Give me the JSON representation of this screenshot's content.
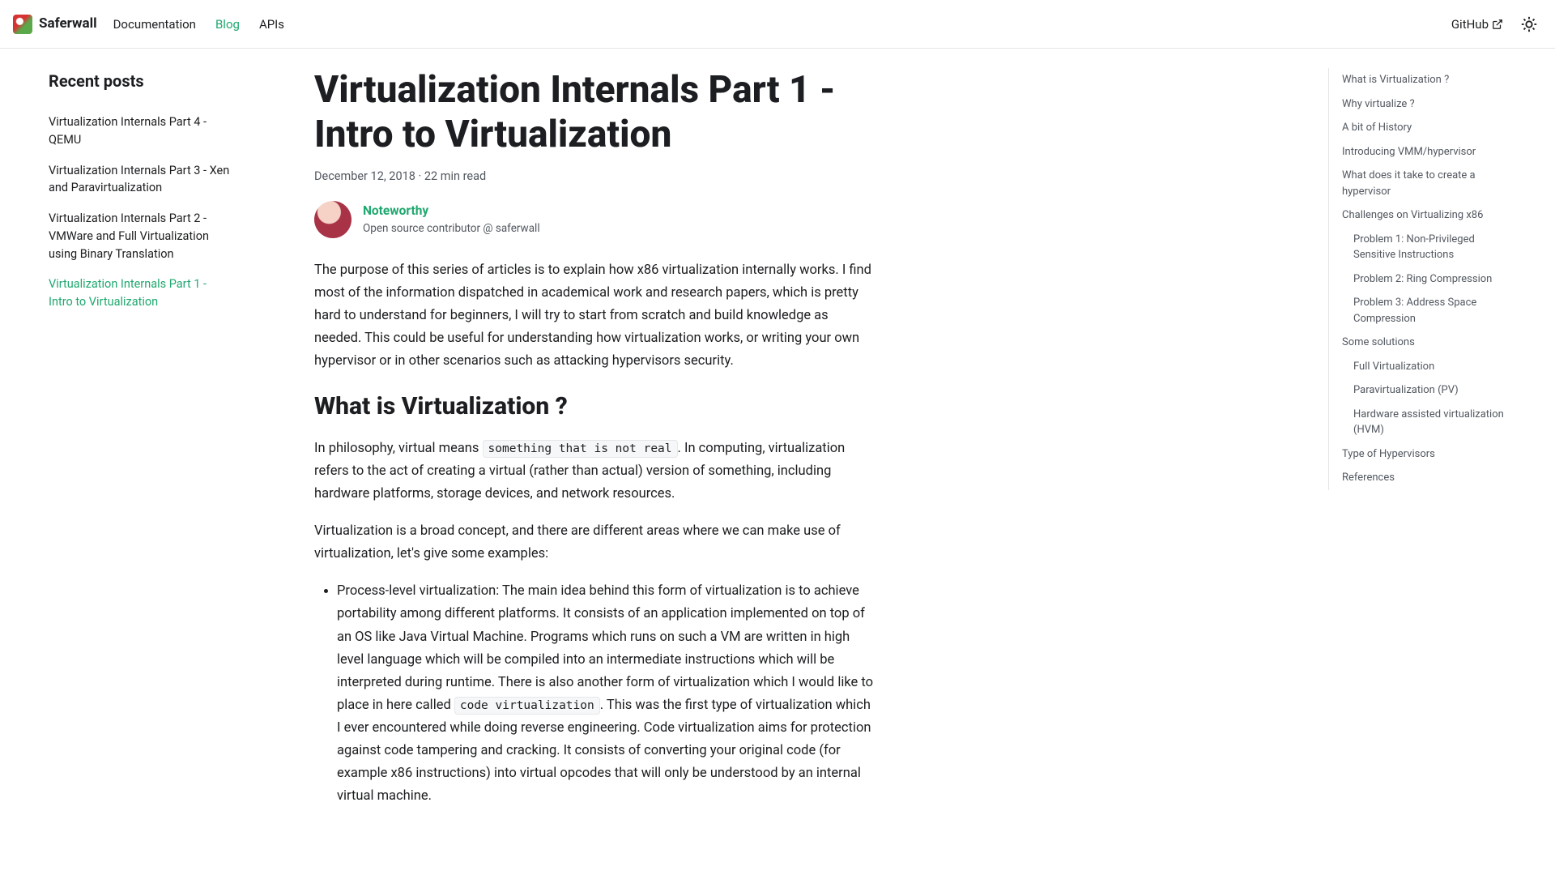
{
  "nav": {
    "brand": "Saferwall",
    "links": [
      "Documentation",
      "Blog",
      "APIs"
    ],
    "active_index": 1,
    "github": "GitHub"
  },
  "sidebar": {
    "heading": "Recent posts",
    "posts": [
      "Virtualization Internals Part 4 - QEMU",
      "Virtualization Internals Part 3 - Xen and Paravirtualization",
      "Virtualization Internals Part 2 - VMWare and Full Virtualization using Binary Translation",
      "Virtualization Internals Part 1 - Intro to Virtualization"
    ],
    "active_index": 3
  },
  "post": {
    "title": "Virtualization Internals Part 1 - Intro to Virtualization",
    "meta": "December 12, 2018 · 22 min read",
    "author_name": "Noteworthy",
    "author_role": "Open source contributor @ saferwall",
    "intro_p": "The purpose of this series of articles is to explain how x86 virtualization internally works. I find most of the information dispatched in academical work and research papers, which is pretty hard to understand for beginners, I will try to start from scratch and build knowledge as needed. This could be useful for understanding how virtualization works, or writing your own hypervisor or in other scenarios such as attacking hypervisors security.",
    "h2_1": "What is Virtualization ?",
    "p2_pre": "In philosophy, virtual means ",
    "code1": "something that is not real",
    "p2_post": ". In computing, virtualization refers to the act of creating a virtual (rather than actual) version of something, including hardware platforms, storage devices, and network resources.",
    "p3": "Virtualization is a broad concept, and there are different areas where we can make use of virtualization, let's give some examples:",
    "li1_pre": "Process-level virtualization: The main idea behind this form of virtualization is to achieve portability among different platforms. It consists of an application implemented on top of an OS like Java Virtual Machine. Programs which runs on such a VM are written in high level language which will be compiled into an intermediate instructions which will be interpreted during runtime. There is also another form of virtualization which I would like to place in here called ",
    "code2": "code virtualization",
    "li1_post": ". This was the first type of virtualization which I ever encountered while doing reverse engineering. Code virtualization aims for protection against code tampering and cracking. It consists of converting your original code (for example x86 instructions) into virtual opcodes that will only be understood by an internal virtual machine."
  },
  "toc": [
    {
      "label": "What is Virtualization ?",
      "sub": false
    },
    {
      "label": "Why virtualize ?",
      "sub": false
    },
    {
      "label": "A bit of History",
      "sub": false
    },
    {
      "label": "Introducing VMM/hypervisor",
      "sub": false
    },
    {
      "label": "What does it take to create a hypervisor",
      "sub": false
    },
    {
      "label": "Challenges on Virtualizing x86",
      "sub": false
    },
    {
      "label": "Problem 1: Non-Privileged Sensitive Instructions",
      "sub": true
    },
    {
      "label": "Problem 2: Ring Compression",
      "sub": true
    },
    {
      "label": "Problem 3: Address Space Compression",
      "sub": true
    },
    {
      "label": "Some solutions",
      "sub": false
    },
    {
      "label": "Full Virtualization",
      "sub": true
    },
    {
      "label": "Paravirtualization (PV)",
      "sub": true
    },
    {
      "label": "Hardware assisted virtualization (HVM)",
      "sub": true
    },
    {
      "label": "Type of Hypervisors",
      "sub": false
    },
    {
      "label": "References",
      "sub": false
    }
  ]
}
